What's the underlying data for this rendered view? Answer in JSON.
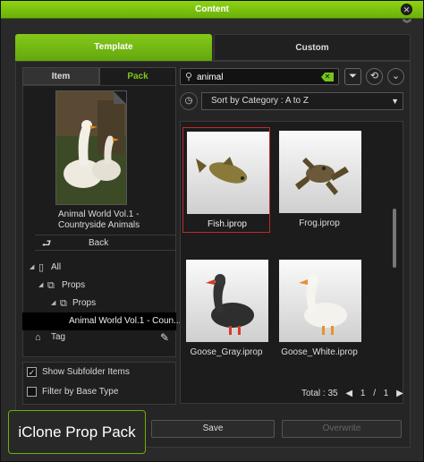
{
  "window": {
    "title": "Content"
  },
  "tabs": {
    "template": "Template",
    "custom": "Custom"
  },
  "left": {
    "subtabs": {
      "item": "Item",
      "pack": "Pack"
    },
    "pack_caption": "Animal World  Vol.1 -\nCountryside Animals",
    "back_label": "Back",
    "tree": [
      {
        "label": "All"
      },
      {
        "label": "Props"
      },
      {
        "label": "Props"
      },
      {
        "label": "Animal World Vol.1 - Coun..."
      }
    ],
    "tag_label": "Tag",
    "show_subfolder": "Show Subfolder Items",
    "filter_base": "Filter by Base Type"
  },
  "search": {
    "value": "animal"
  },
  "sort": {
    "label": "Sort by Category : A to Z"
  },
  "items": [
    {
      "name": "Fish.iprop",
      "icon": "fish-icon"
    },
    {
      "name": "Frog.iprop",
      "icon": "frog-icon"
    },
    {
      "name": "Goose_Gray.iprop",
      "icon": "goose-icon"
    },
    {
      "name": "Goose_White.iprop",
      "icon": "goose-icon"
    }
  ],
  "pager": {
    "total": "Total : 35",
    "page": "1",
    "sep": "/",
    "pages": "1"
  },
  "buttons": {
    "save": "Save",
    "overwrite": "Overwrite"
  },
  "badge": "iClone Prop Pack",
  "colors": {
    "accent": "#7ec51a",
    "selection": "#c0282a"
  }
}
